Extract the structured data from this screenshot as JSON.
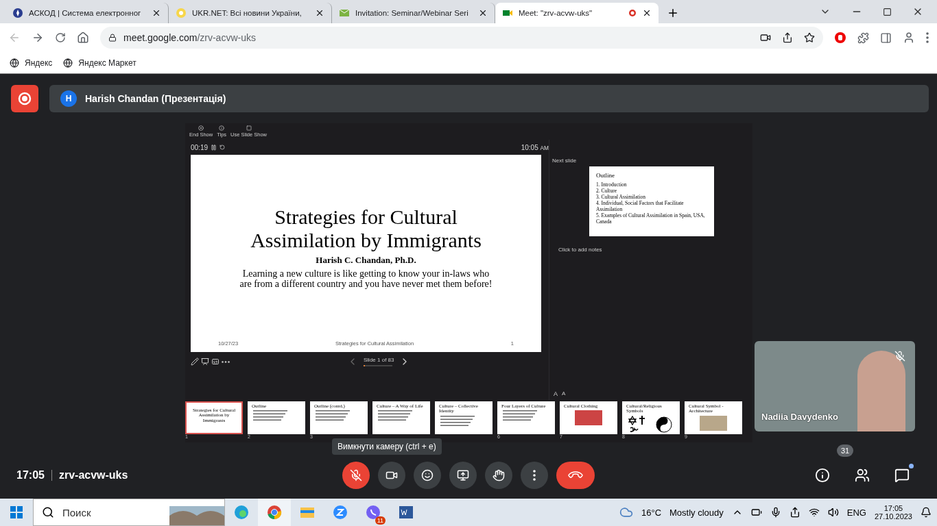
{
  "browser": {
    "tabs": [
      {
        "title": "АСКОД | Система електронног",
        "selected": false
      },
      {
        "title": "UKR.NET: Всі новини України,",
        "selected": false
      },
      {
        "title": "Invitation: Seminar/Webinar Seri",
        "selected": false
      },
      {
        "title": "Meet: \"zrv-acvw-uks\"",
        "selected": true,
        "recording": true
      }
    ],
    "url_host": "meet.google.com",
    "url_path": "/zrv-acvw-uks",
    "bookmarks": [
      "Яндекс",
      "Яндекс Маркет"
    ]
  },
  "meet": {
    "presenter_initial": "H",
    "presenter_label": "Harish Chandan (Презентація)",
    "presenter": {
      "toolbar": [
        "End Show",
        "Tips",
        "Use Slide Show"
      ],
      "timer": "00:19",
      "clock": "10:05",
      "clock_suffix": "AM",
      "slide": {
        "title": "Strategies for Cultural Assimilation by Immigrants",
        "author": "Harish C. Chandan, Ph.D.",
        "quote": "Learning a new culture is like getting to know your in-laws who are from a different country and you have never met them before!",
        "footer_date": "10/27/23",
        "footer_title": "Strategies for Cultural Assimilation",
        "footer_number": "1"
      },
      "slide_counter": "Slide 1 of 83",
      "level": 0.04,
      "next_label": "Next slide",
      "next_slide": {
        "title": "Outline",
        "items": [
          "1. Introduction",
          "2. Culture",
          "3. Cultural Assimilation",
          "4. Individual, Social Factors that Facilitate Assimilation",
          "5. Examples of Cultural Assimilation in Spain, USA, Canada"
        ]
      },
      "notes_placeholder": "Click to add notes",
      "text_size_buttons": [
        "A",
        "A"
      ],
      "thumbnails": [
        {
          "number": "1",
          "title": "Strategies for Cultural Assimilation by Immigrants",
          "kind": "title",
          "selected": true
        },
        {
          "number": "2",
          "title": "Outline",
          "kind": "text",
          "selected": false
        },
        {
          "number": "3",
          "title": "Outline (contd.)",
          "kind": "text",
          "selected": false
        },
        {
          "title": "Culture – A Way of Life",
          "kind": "text",
          "selected": false
        },
        {
          "title": "Culture – Collective Identity",
          "kind": "text",
          "selected": false
        },
        {
          "number": "6",
          "title": "Four Layers of Culture",
          "kind": "text",
          "selected": false
        },
        {
          "number": "7",
          "title": "Cultural Clothing",
          "kind": "photo",
          "selected": false
        },
        {
          "number": "8",
          "title": "Cultural/Religious Symbols",
          "kind": "symbols",
          "selected": false
        },
        {
          "number": "9",
          "title": "Cultural Symbol - Architecture",
          "kind": "photo",
          "selected": false
        }
      ]
    },
    "participant": {
      "name": "Nadiia Davydenko",
      "muted": true
    },
    "tooltip": "Вимкнути камеру (ctrl + e)",
    "time": "17:05",
    "meeting_code": "zrv-acvw-uks",
    "mic_muted": true,
    "participants_count": "31",
    "chat_unread": true
  },
  "taskbar": {
    "search_placeholder": "Поиск",
    "viber_badge": "11",
    "temperature": "16°C",
    "weather": "Mostly cloudy",
    "language": "ENG",
    "time": "17:05",
    "date": "27.10.2023"
  }
}
